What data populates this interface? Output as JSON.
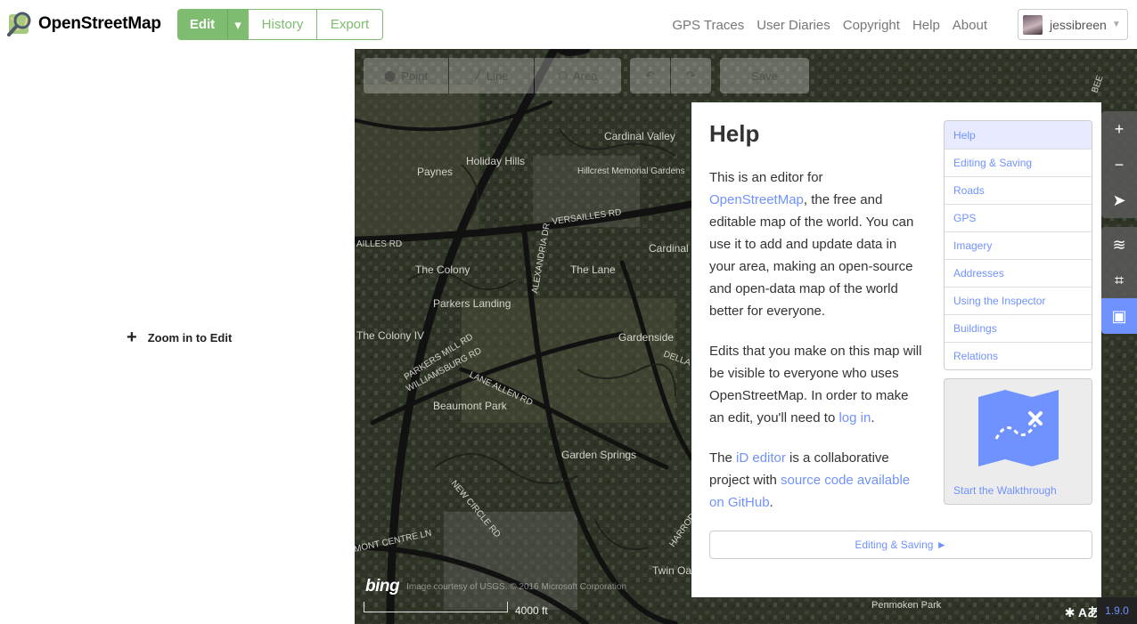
{
  "app": {
    "name": "OpenStreetMap"
  },
  "tabs": {
    "edit": "Edit",
    "history": "History",
    "export": "Export"
  },
  "nav": {
    "items": [
      "GPS Traces",
      "User Diaries",
      "Copyright",
      "Help",
      "About"
    ]
  },
  "user": {
    "name": "jessibreen"
  },
  "sidebar": {
    "zoom_to_edit": "Zoom in to Edit"
  },
  "toolbar": {
    "point": "Point",
    "line": "Line",
    "area": "Area",
    "save": "Save"
  },
  "map": {
    "attribution": "Image courtesy of USGS. © 2016 Microsoft Corporation",
    "bing": "bing",
    "scale": "4000 ft",
    "version": "1.9.0",
    "labels": [
      "Cardinal Valley",
      "Holiday Hills",
      "Hillcrest Memorial Gardens",
      "Paynes",
      "VERSAILLES RD",
      "AILLES RD",
      "ALEXANDRIA DR",
      "The Colony",
      "The Lane",
      "Cardinal",
      "Parkers Landing",
      "The Colony IV",
      "Gardenside",
      "PARKERS MILL RD",
      "WILLIAMSBURG RD",
      "LANE ALLEN RD",
      "DELLA DR",
      "Beaumont Park",
      "Garden Springs",
      "NEW CIRCLE RD",
      "MONT CENTRE LN",
      "Twin Oaks",
      "HARRODSBURG",
      "Penmoken Park",
      "BEE"
    ]
  },
  "help": {
    "title": "Help",
    "p1_pre": "This is an editor for ",
    "p1_link": "OpenStreetMap",
    "p1_post": ", the free and editable map of the world. You can use it to add and update data in your area, making an open-source and open-data map of the world better for everyone.",
    "p2_pre": "Edits that you make on this map will be visible to everyone who uses OpenStreetMap. In order to make an edit, you'll need to ",
    "p2_link": "log in",
    "p2_post": ".",
    "p3_pre": "The ",
    "p3_link1": "iD editor",
    "p3_mid": " is a collaborative project with ",
    "p3_link2": "source code available on GitHub",
    "p3_post": ".",
    "toc": [
      "Help",
      "Editing & Saving",
      "Roads",
      "GPS",
      "Imagery",
      "Addresses",
      "Using the Inspector",
      "Buildings",
      "Relations"
    ],
    "walkthrough": "Start the Walkthrough",
    "next": "Editing & Saving ►"
  },
  "colors": {
    "osm_green": "#7ebc6f",
    "link_blue": "#7092ff"
  }
}
